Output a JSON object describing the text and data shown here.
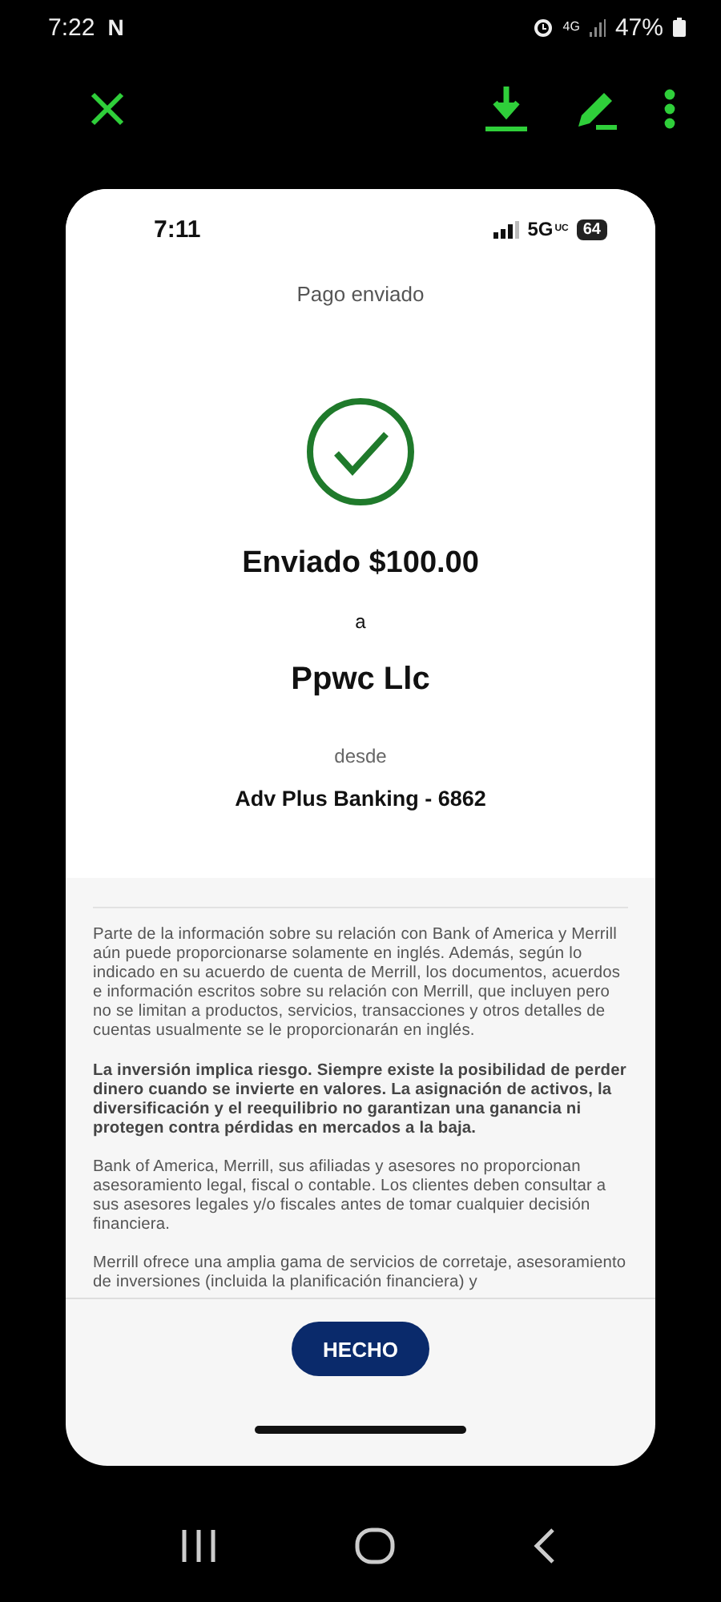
{
  "device_status_bar": {
    "time": "7:22",
    "notification": "N",
    "network": "4G",
    "battery": "47%"
  },
  "receipt": {
    "status_bar": {
      "time": "7:11",
      "network": "5G",
      "network_suffix": "UC",
      "battery": "64"
    },
    "title": "Pago enviado",
    "amount": "Enviado $100.00",
    "connector": "a",
    "recipient": "Ppwc Llc",
    "from_label": "desde",
    "account": "Adv Plus Banking - 6862",
    "disclaimers": [
      {
        "text": "Parte de la información sobre su relación con Bank of America y Merrill aún puede proporcionarse solamente en inglés. Además, según lo indicado en su acuerdo de cuenta de Merrill, los documentos, acuerdos e información escritos sobre su relación con Merrill, que incluyen pero no se limitan a productos, servicios, transacciones y otros detalles de cuentas usualmente se le proporcionarán en inglés.",
        "bold": false
      },
      {
        "text": "La inversión implica riesgo. Siempre existe la posibilidad de perder dinero cuando se invierte en valores. La asignación de activos, la diversificación y el reequilibrio no garantizan una ganancia ni protegen contra pérdidas en mercados a la baja.",
        "bold": true
      },
      {
        "text": "Bank of America, Merrill, sus afiliadas y asesores no proporcionan asesoramiento legal, fiscal o contable. Los clientes deben consultar a sus asesores legales y/o fiscales antes de tomar cualquier decisión financiera.",
        "bold": false
      },
      {
        "text": "Merrill ofrece una amplia gama de servicios de corretaje, asesoramiento de inversiones (incluida la planificación financiera) y",
        "bold": false
      }
    ],
    "button": "HECHO"
  }
}
